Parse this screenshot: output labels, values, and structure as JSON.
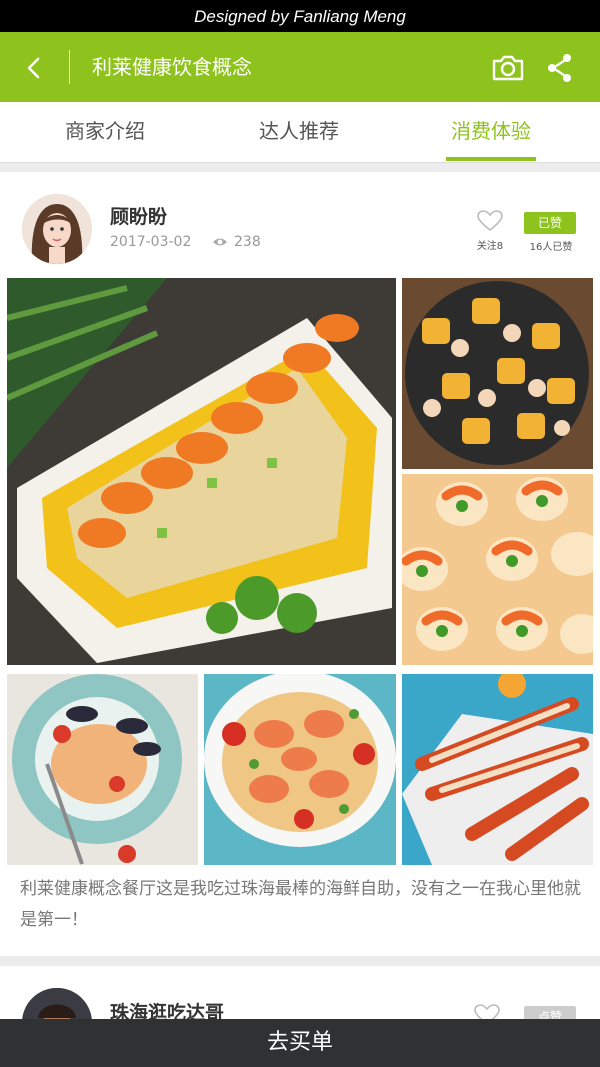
{
  "credit": "Designed by Fanliang Meng",
  "header": {
    "title": "利莱健康饮食概念"
  },
  "tabs": [
    {
      "label": "商家介绍",
      "active": false
    },
    {
      "label": "达人推荐",
      "active": false
    },
    {
      "label": "消费体验",
      "active": true
    }
  ],
  "colors": {
    "accent": "#8ec31e",
    "buy_bar": "#2f3133"
  },
  "posts": [
    {
      "user": "顾盼盼",
      "date": "2017-03-02",
      "views": "238",
      "follow_label": "关注8",
      "liked_badge": "已赞",
      "liked_count": "16人已赞",
      "text": "利莱健康概念餐厅这是我吃过珠海最棒的海鲜自助，没有之一在我心里他就是第一！"
    },
    {
      "user": "珠海逛吃达哥",
      "liked_badge": "点赞"
    }
  ],
  "icons": [
    "back-icon",
    "camera-icon",
    "share-icon",
    "eye-icon",
    "heart-icon"
  ],
  "footer": {
    "buy_label": "去买单"
  }
}
